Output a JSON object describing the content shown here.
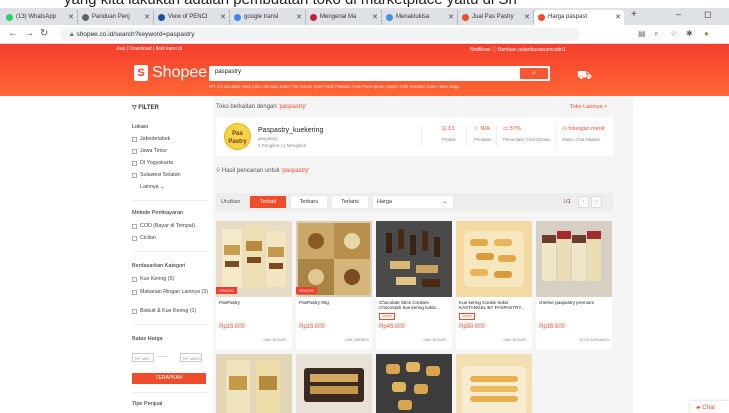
{
  "caption": "yang kita lakukan adalah pembuatan toko di marketplace yaitu di Sh",
  "browser": {
    "tabs": [
      {
        "label": "(13) WhatsApp",
        "color": "#25d366"
      },
      {
        "label": "Panduan Penj",
        "color": "#5f6368"
      },
      {
        "label": "View of PENCI",
        "color": "#1a4e9c"
      },
      {
        "label": "google transl",
        "color": "#4285f4"
      },
      {
        "label": "Mengenal Ma",
        "color": "#c41e3a"
      },
      {
        "label": "Menakluklsa",
        "color": "#4a90d9"
      },
      {
        "label": "Jual Pas Pastry",
        "color": "#ee4d2d"
      },
      {
        "label": "Harga paspast",
        "color": "#ee4d2d"
      }
    ],
    "url": "shopee.co.id/search?keyword=paspastry"
  },
  "header": {
    "top_links_left": "Jual  |  Download  |  Ikuti kami di",
    "top_links_right": "Notifikasi   ⓘ Bantuan   putaribusianamustiri1",
    "logo_text": "Shopee",
    "search_query": "paspastry",
    "search_hints": "KIT 1/3  Dw Baju Anak Laki Laki  Baju Koko Pria  Gamis Syar'i Wolf  Pakaian Anak Perempuan  Abaya Turki  Sweater Gene  Hahn Bags"
  },
  "filters": {
    "title": "FILTER",
    "lokasi": {
      "title": "Lokasi",
      "items": [
        "Jabodetabek",
        "Jawa Timur",
        "DI Yogyakarta",
        "Sulawesi Selatan"
      ],
      "more": "Lainnya ⌄"
    },
    "metode": {
      "title": "Metode Pembayaran",
      "items": [
        "COD (Bayar di Tempat)",
        "Cicilan"
      ]
    },
    "kategori": {
      "title": "Berdasarkan Kategori",
      "items": [
        "Kue Kering (5)",
        "Makanan Ringan Lainnya (3)",
        "Biskuit & Kue Kering (1)"
      ]
    },
    "harga": {
      "title": "Batas Harga",
      "min_placeholder": "RP MIN",
      "max_placeholder": "RP MAKS",
      "apply": "TERAPKAN"
    },
    "penjual": {
      "title": "Tipe Penjual"
    }
  },
  "shop": {
    "label_prefix": "Toko berkaitan dengan ",
    "label_query": "'paspastry'",
    "more": "Toko Lainnya >",
    "logo_text": "Pas Pastry",
    "name": "Paspastry_kuekering",
    "handle": "paspastry",
    "followers": "4 Pengikut  |  1 Mengikuti",
    "stats": [
      {
        "value": "13",
        "label": "Produk"
      },
      {
        "value": "N/A",
        "label": "Penilaian"
      },
      {
        "value": "57%",
        "label": "Persentase Chat Dibalas"
      },
      {
        "value": "hitungan menit",
        "label": "Waktu Chat Dibalas"
      }
    ]
  },
  "results": {
    "prefix": "Hasil pencarian untuk ",
    "query": "'paspastry'"
  },
  "sort": {
    "label": "Urutkan",
    "options": [
      "Terkait",
      "Terbaru",
      "Terlaris"
    ],
    "price": "Harga",
    "page": "1",
    "pages": "/1"
  },
  "products": [
    {
      "name": "PasPastry",
      "price": "Rp15.000",
      "location": "KAB. BOGOR...",
      "badge": "GRATIS",
      "tag": ""
    },
    {
      "name": "PasPastry 60g",
      "price": "Rp15.000",
      "location": "KAB. BREBES",
      "badge": "GRATIS",
      "tag": ""
    },
    {
      "name": "Chocolate Stick Cookies Chocostick kue kering kukis...",
      "price": "Rp45.000",
      "location": "KAB. BOGOR...",
      "badge": "",
      "tag": "Grosir"
    },
    {
      "name": "Kue kering Cookie kukis KASTANGEL BY PASPASTRY...",
      "price": "Rp50.000",
      "location": "KAB. BOGOR...",
      "badge": "",
      "tag": "Grosir"
    },
    {
      "name": "cheese paspastry premium",
      "price": "Rp16.500",
      "location": "KOTA SURABAYA",
      "badge": "",
      "tag": ""
    }
  ],
  "chat": "Chat"
}
